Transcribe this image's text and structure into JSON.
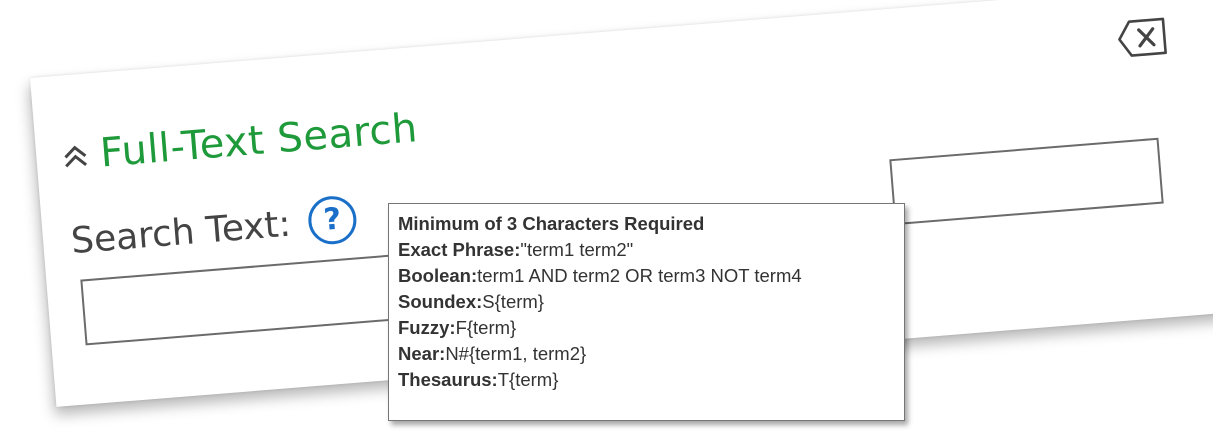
{
  "panel": {
    "title": "Full-Text Search",
    "search_label": "Search Text:",
    "help_symbol": "?",
    "search_input_value": "",
    "icons": {
      "close": "close-backspace-icon",
      "collapse": "double-chevron-up-icon",
      "help": "help-question-icon"
    }
  },
  "colors": {
    "title": "#1e9a3a",
    "help": "#1a6fc9",
    "label": "#444444"
  },
  "tooltip": {
    "heading": "Minimum of 3 Characters Required",
    "rows": [
      {
        "label": "Exact Phrase:",
        "value": "\"term1 term2\""
      },
      {
        "label": "Boolean:",
        "value": "term1 AND term2 OR term3 NOT term4"
      },
      {
        "label": "Soundex:",
        "value": "S{term}"
      },
      {
        "label": "Fuzzy:",
        "value": "F{term}"
      },
      {
        "label": "Near:",
        "value": "N#{term1, term2}"
      },
      {
        "label": "Thesaurus:",
        "value": "T{term}"
      }
    ]
  }
}
